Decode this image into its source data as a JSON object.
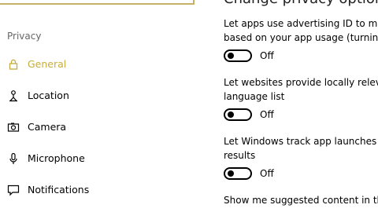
{
  "search": {
    "placeholder": ""
  },
  "header": {
    "title": "Change privacy options"
  },
  "sidebar": {
    "section_title": "Privacy",
    "items": [
      {
        "label": "General",
        "icon": "lock-icon",
        "active": true
      },
      {
        "label": "Location",
        "icon": "location-person-icon",
        "active": false
      },
      {
        "label": "Camera",
        "icon": "camera-icon",
        "active": false
      },
      {
        "label": "Microphone",
        "icon": "microphone-icon",
        "active": false
      },
      {
        "label": "Notifications",
        "icon": "chat-bubble-icon",
        "active": false
      }
    ]
  },
  "options": [
    {
      "line1": "Let apps use advertising ID to make ads more interesting to you",
      "line2": "based on your app usage (turning this off will reset your ID)",
      "toggle_label": "Off"
    },
    {
      "line1": "Let websites provide locally relevant content by accessing my",
      "line2": "language list",
      "toggle_label": "Off"
    },
    {
      "line1": "Let Windows track app launches to improve Start and search",
      "line2": "results",
      "toggle_label": "Off"
    },
    {
      "line1": "Show me suggested content in the Settings app"
    }
  ],
  "colors": {
    "accent": "#c6ac3e",
    "muted": "#666666"
  }
}
